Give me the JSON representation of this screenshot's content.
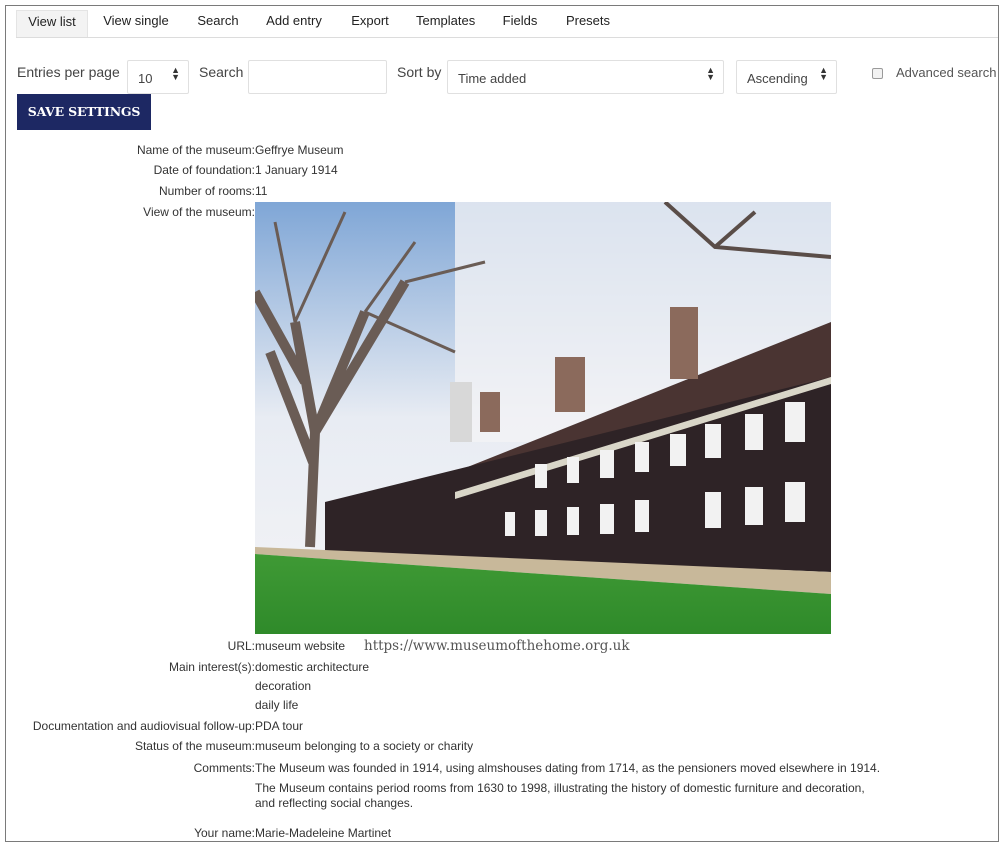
{
  "tabs": [
    {
      "label": "View list",
      "active": true
    },
    {
      "label": "View single",
      "active": false
    },
    {
      "label": "Search",
      "active": false
    },
    {
      "label": "Add entry",
      "active": false
    },
    {
      "label": "Export",
      "active": false
    },
    {
      "label": "Templates",
      "active": false
    },
    {
      "label": "Fields",
      "active": false
    },
    {
      "label": "Presets",
      "active": false
    }
  ],
  "controls": {
    "entries_label": "Entries per page",
    "entries_value": "10",
    "search_label": "Search",
    "search_value": "",
    "sort_label": "Sort by",
    "sort_value": "Time added",
    "order_value": "Ascending",
    "advanced_label": "Advanced search",
    "advanced_checked": false,
    "save_label": "SAVE SETTINGS"
  },
  "colors": {
    "button_bg": "#1d2863",
    "link": "#1d2863",
    "frame_border": "#7a7a7a"
  },
  "entry": {
    "name_label": "Name of the museum:",
    "name_value": "Geffrye Museum",
    "date_label": "Date of foundation:",
    "date_value": "1 January 1914",
    "rooms_label": "Number of rooms:",
    "rooms_value": "11",
    "view_label": "View of the museum:",
    "view_image": "photo of almshouse buildings with bare trees and lawn",
    "url_label": "URL:",
    "url_link": "museum website",
    "url_text": "https://www.museumofthehome.org.uk",
    "interests_label": "Main interest(s):",
    "interests": [
      "domestic architecture",
      "decoration",
      "daily life"
    ],
    "doc_label": "Documentation and audiovisual follow-up:",
    "doc_value": "PDA tour",
    "status_label": "Status of the museum:",
    "status_value": "museum belonging to a society or charity",
    "comments_label": "Comments:",
    "comments": [
      "The Museum was founded in 1914, using almshouses dating from 1714, as the pensioners moved elsewhere in 1914.",
      "The Museum contains period rooms from 1630 to 1998, illustrating the history of domestic furniture and decoration,",
      "and reflecting social changes."
    ],
    "yourname_label": "Your name:",
    "yourname_value": "Marie-Madeleine Martinet"
  }
}
